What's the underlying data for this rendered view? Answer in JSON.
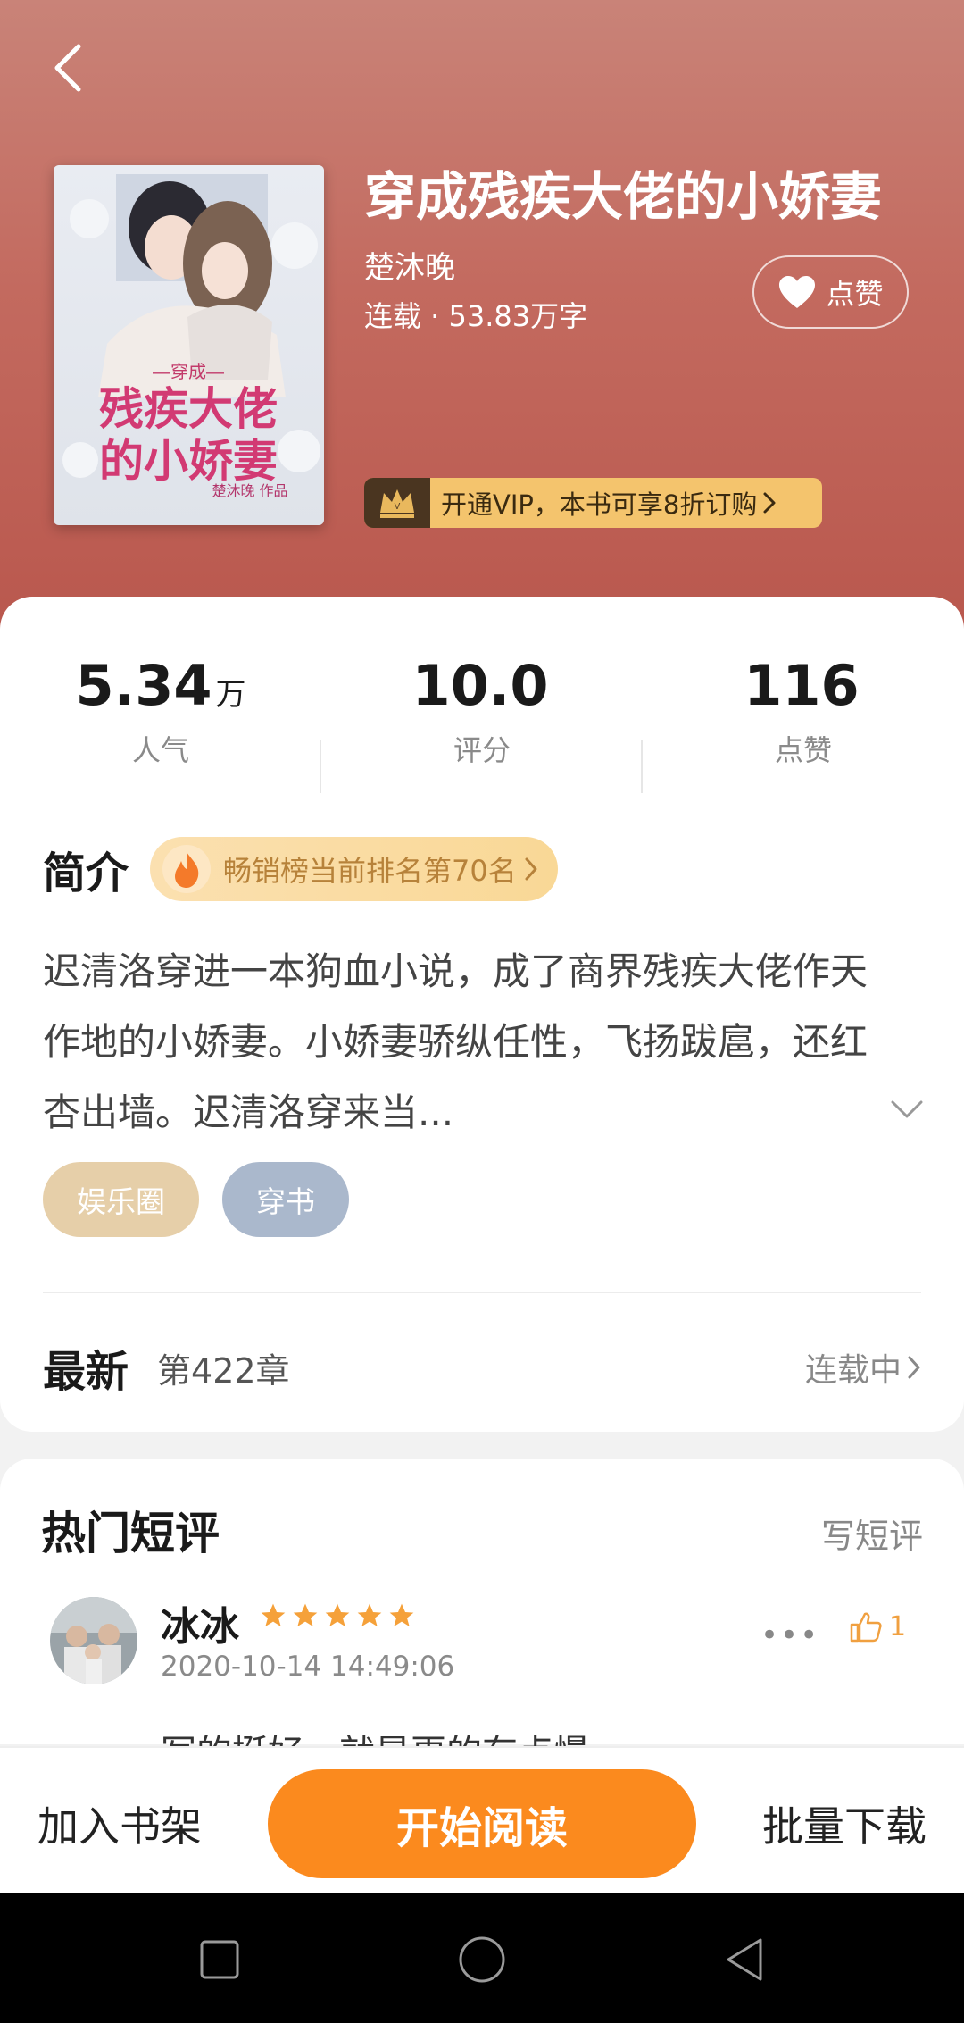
{
  "header": {
    "back_icon": "chevron-left-icon"
  },
  "book": {
    "title": "穿成残疾大佬的小娇妻",
    "author": "楚沐晚",
    "meta": "连载 · 53.83万字",
    "cover_alt_text": "穿成残疾大佬的小娇妻 楚沐晚 作品"
  },
  "like_button": {
    "label": "点赞",
    "icon": "heart-icon"
  },
  "vip_banner": {
    "label": "开通VIP，本书可享8折订购"
  },
  "stats": [
    {
      "value": "5.34",
      "unit": "万",
      "label": "人气"
    },
    {
      "value": "10.0",
      "unit": "",
      "label": "评分"
    },
    {
      "value": "116",
      "unit": "",
      "label": "点赞"
    }
  ],
  "intro": {
    "title": "简介",
    "rank_label": "畅销榜当前排名第70名",
    "description": "迟清洛穿进一本狗血小说，成了商界残疾大佬作天作地的小娇妻。小娇妻骄纵任性，飞扬跋扈，还红杏出墙。迟清洛穿来当..."
  },
  "tags": [
    "娱乐圈",
    "穿书"
  ],
  "latest": {
    "title": "最新",
    "chapter": "第422章",
    "status": "连载中"
  },
  "reviews": {
    "title": "热门短评",
    "write_label": "写短评",
    "items": [
      {
        "user": "冰冰",
        "rating": 5,
        "time": "2020-10-14 14:49:06",
        "likes": "1",
        "text": "写的挺好，就是更的有点慢"
      }
    ]
  },
  "bottom_bar": {
    "add_shelf": "加入书架",
    "start_reading": "开始阅读",
    "batch_download": "批量下载"
  },
  "colors": {
    "hero": "#c36a5f",
    "accent": "#fb8a1e",
    "vip": "#f4c46d",
    "star": "#f5a13a"
  }
}
